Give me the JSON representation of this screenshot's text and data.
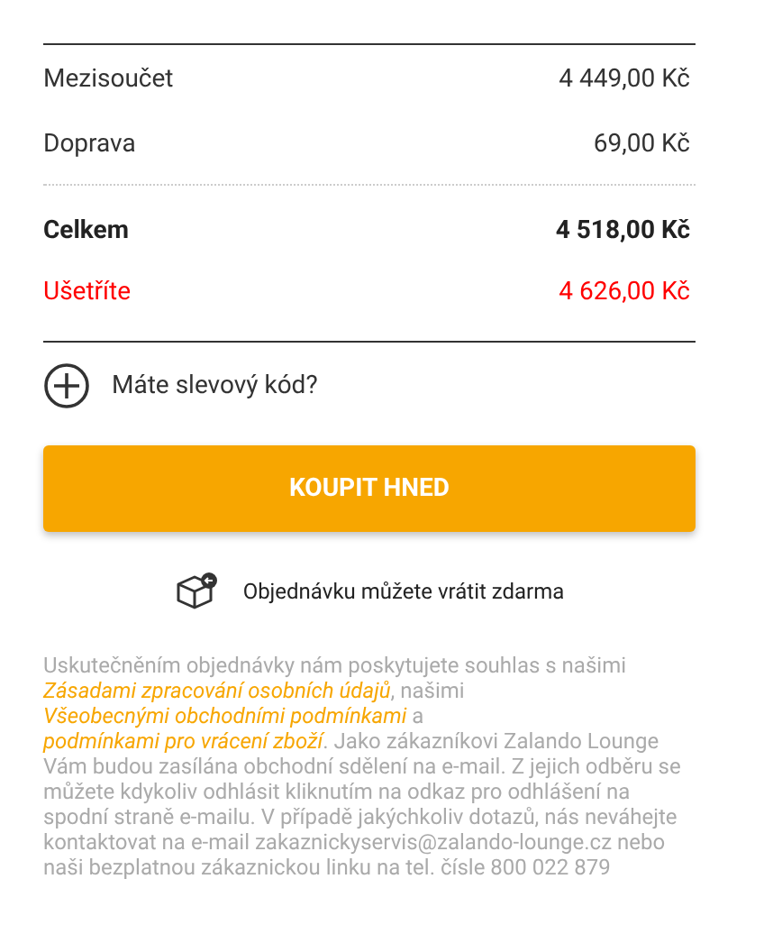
{
  "summary": [
    {
      "kind": "normal",
      "label": "Mezisoučet",
      "value": "4 449,00 Kč"
    },
    {
      "kind": "normal",
      "label": "Doprava",
      "value": "69,00 Kč"
    },
    {
      "kind": "total",
      "label": "Celkem",
      "value": "4 518,00 Kč"
    },
    {
      "kind": "savings",
      "label": "Ušetříte",
      "value": "4 626,00 Kč"
    }
  ],
  "discount": {
    "label": "Máte slevový kód?"
  },
  "buy_button": {
    "label": "KOUPIT HNED"
  },
  "returns": {
    "text": "Objednávku můžete vrátit zdarma"
  },
  "legal": [
    {
      "kind": "text",
      "text": "Uskutečněním objednávky nám poskytujete souhlas s našimi"
    },
    {
      "kind": "link",
      "text": "Zásadami zpracování osobních údajů"
    },
    {
      "kind": "text",
      "text": ", našimi"
    },
    {
      "kind": "link",
      "text": "Všeobecnými obchodními podmínkami"
    },
    {
      "kind": "text",
      "text": "a"
    },
    {
      "kind": "link",
      "text": "podmínkami pro vrácení zboží"
    },
    {
      "kind": "text",
      "text": ". Jako zákazníkovi Zalando Lounge Vám budou zasílána obchodní sdělení na e-mail. Z jejich odběru se můžete kdykoliv odhlásit kliknutím na odkaz pro odhlášení na spodní straně e-mailu. V případě jakýchkoliv dotazů, nás neváhejte kontaktovat na e-mail zakaznickyservis@zalando-lounge.cz nebo naši bezplatnou zákaznickou linku na tel. čísle 800 022 879"
    }
  ]
}
